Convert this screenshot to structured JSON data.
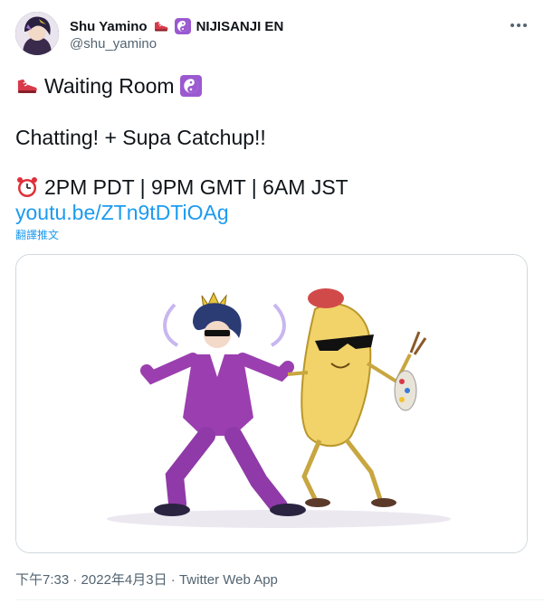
{
  "author": {
    "display_name": "Shu Yamino",
    "affiliation": "NIJISANJI EN",
    "handle": "@shu_yamino"
  },
  "tweet": {
    "line1": "Waiting Room",
    "line2": "Chatting! + Supa Catchup!!",
    "line3": "2PM PDT | 9PM GMT | 6AM JST",
    "link": "youtu.be/ZTn9tDTiOAg",
    "translate": "翻譯推文"
  },
  "meta": {
    "time": "下午7:33",
    "sep1": " · ",
    "date": "2022年4月3日",
    "sep2": " · ",
    "client": "Twitter Web App"
  },
  "icons": {
    "shoe": "sneaker-icon",
    "yin_yang": "yin-yang-icon",
    "clock": "alarm-clock-icon",
    "more": "more-dots-icon"
  },
  "colors": {
    "link": "#1d9bf0",
    "secondary_text": "#536471",
    "primary_text": "#0f1419",
    "yin_yang_bg": "#9b59d0",
    "shoe_red": "#d83a4a"
  }
}
